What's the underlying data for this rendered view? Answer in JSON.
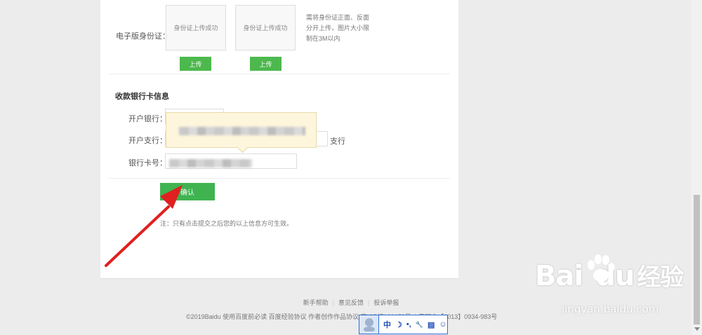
{
  "id_card": {
    "label": "电子版身份证：",
    "slots": [
      {
        "status": "身份证上传成功",
        "button": "上传"
      },
      {
        "status": "身份证上传成功",
        "button": "上传"
      }
    ],
    "hint": "需将身份证正面、反面分开上传，图片大小限制在3M以内"
  },
  "bank": {
    "section_title": "收款银行卡信息",
    "bank_label": "开户银行：",
    "branch_label": "开户支行：",
    "branch_suffix": "支行",
    "card_label": "银行卡号："
  },
  "confirm_button": "确认",
  "note": "注：只有点击提交之后您的以上信息方可生效。",
  "footer": {
    "links": [
      "新手帮助",
      "意见反馈",
      "投诉举报"
    ],
    "copyright": "©2019Baidu  使用百度前必读  百度经验协议  作者创作作品协议  京ICP证030173号-1 京网文【2013】0934-983号"
  },
  "ime": {
    "items": [
      "中",
      "☽",
      "•,",
      "🔧",
      "▤",
      "☺"
    ]
  },
  "watermark": {
    "brand": "Bai",
    "brand2": "du",
    "cn": "经验",
    "url": "jingyan.baidu.com"
  },
  "colors": {
    "accent_green": "#3fb34f",
    "annotation_arrow": "#e02020",
    "tooltip_bg": "#fdf6dc"
  }
}
